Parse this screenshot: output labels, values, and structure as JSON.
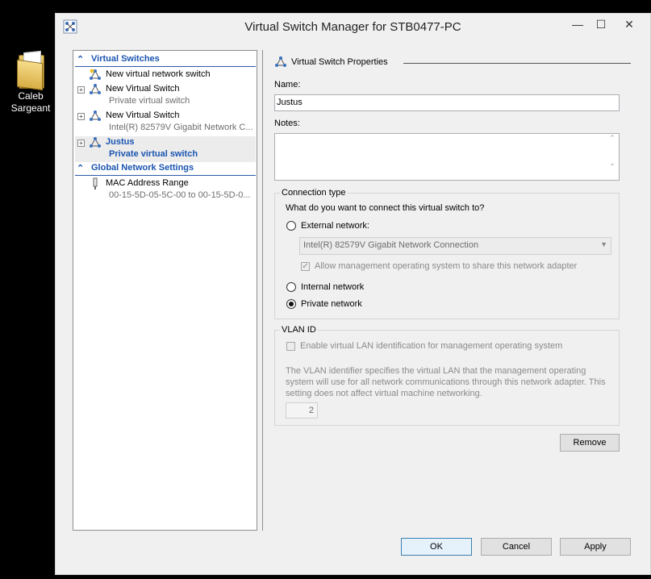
{
  "desktop": {
    "icon_label_line1": "Caleb",
    "icon_label_line2": "Sargeant"
  },
  "window": {
    "title": "Virtual Switch Manager for STB0477-PC",
    "controls": {
      "minimize": "—",
      "maximize": "☐",
      "close": "✕"
    }
  },
  "tree": {
    "virtual_switches_header": "Virtual Switches",
    "items": [
      {
        "label": "New virtual network switch",
        "sub": ""
      },
      {
        "label": "New Virtual Switch",
        "sub": "Private virtual switch"
      },
      {
        "label": "New Virtual Switch",
        "sub": "Intel(R) 82579V Gigabit Network C..."
      },
      {
        "label": "Justus",
        "sub": "Private virtual switch"
      }
    ],
    "global_header": "Global Network Settings",
    "mac": {
      "label": "MAC Address Range",
      "sub": "00-15-5D-05-5C-00 to 00-15-5D-0..."
    }
  },
  "props": {
    "header": "Virtual Switch Properties",
    "name_label": "Name:",
    "name_value": "Justus",
    "notes_label": "Notes:",
    "notes_value": "",
    "connection_type": {
      "title": "Connection type",
      "question": "What do you want to connect this virtual switch to?",
      "external_label": "External network:",
      "adapter_value": "Intel(R) 82579V Gigabit Network Connection",
      "allow_mgmt_label": "Allow management operating system to share this network adapter",
      "internal_label": "Internal network",
      "private_label": "Private network",
      "selected": "private"
    },
    "vlan": {
      "title": "VLAN ID",
      "enable_label": "Enable virtual LAN identification for management operating system",
      "description": "The VLAN identifier specifies the virtual LAN that the management operating system will use for all network communications through this network adapter. This setting does not affect virtual machine networking.",
      "value": "2"
    },
    "remove_button": "Remove"
  },
  "footer": {
    "ok": "OK",
    "cancel": "Cancel",
    "apply": "Apply"
  }
}
